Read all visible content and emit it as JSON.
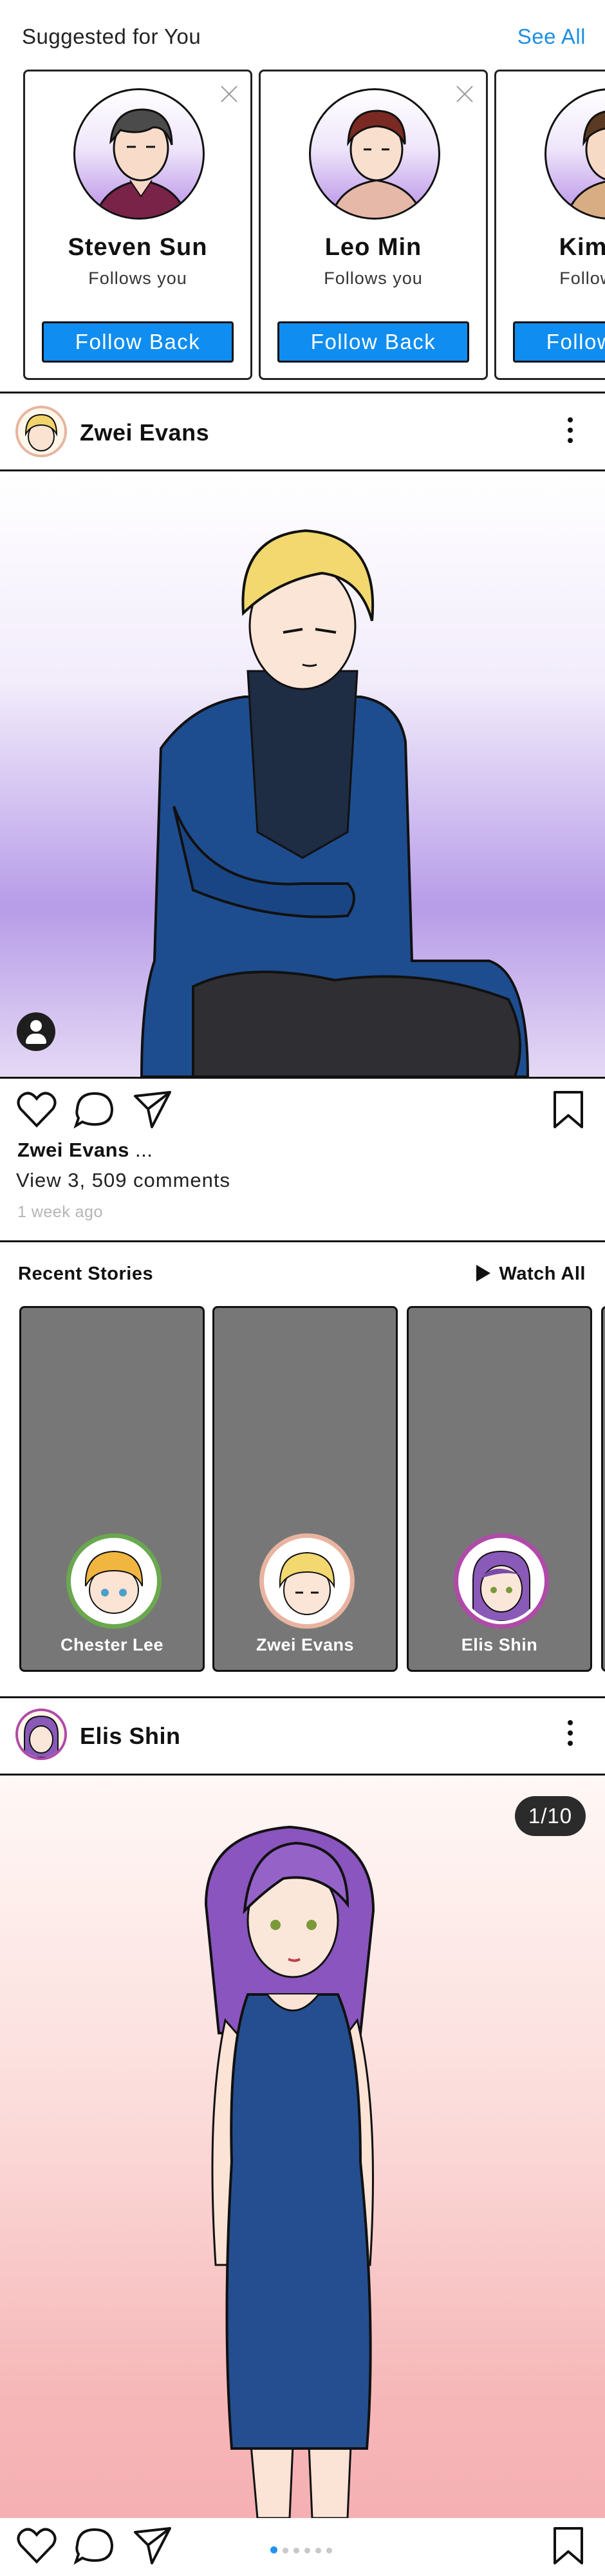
{
  "suggested": {
    "title": "Suggested for You",
    "see_all": "See All",
    "cards": [
      {
        "name": "Steven Sun",
        "sub": "Follows you",
        "button": "Follow Back"
      },
      {
        "name": "Leo Min",
        "sub": "Follows you",
        "button": "Follow Back"
      },
      {
        "name": "Kim Min",
        "sub": "Follows you",
        "button": "Follow Back"
      }
    ]
  },
  "post1": {
    "author": "Zwei Evans",
    "caption_name": "Zwei Evans",
    "caption_more": " ...",
    "comments": "View 3, 509 comments",
    "time": "1 week ago"
  },
  "stories": {
    "title": "Recent Stories",
    "watch_all": "Watch All",
    "items": [
      {
        "name": "Chester Lee",
        "ring": "#6aa84f"
      },
      {
        "name": "Zwei Evans",
        "ring": "#e8b4a0"
      },
      {
        "name": "Elis Shin",
        "ring": "#b04aa8"
      }
    ]
  },
  "post2": {
    "author": "Elis Shin",
    "counter": "1/10"
  },
  "colors": {
    "accent": "#0f8df0",
    "link": "#1d8fe0"
  }
}
